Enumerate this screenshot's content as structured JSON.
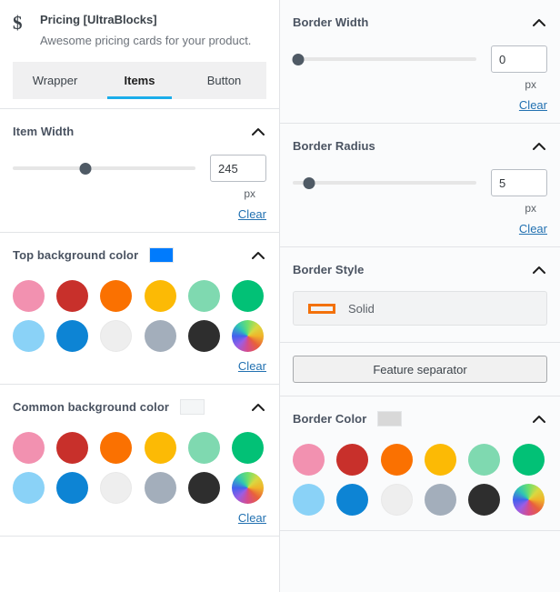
{
  "block_header": {
    "icon": "dollar-icon",
    "icon_glyph": "$",
    "title": "Pricing [UltraBlocks]",
    "description": "Awesome pricing cards for your product."
  },
  "tabs": [
    {
      "label": "Wrapper",
      "active": false
    },
    {
      "label": "Items",
      "active": true
    },
    {
      "label": "Button",
      "active": false
    }
  ],
  "accent_color": "#1badea",
  "link_color": "#2271b1",
  "palette": [
    {
      "name": "pink",
      "hex": "#f291b0",
      "bordered": false
    },
    {
      "name": "red",
      "hex": "#c8302b",
      "bordered": false
    },
    {
      "name": "orange",
      "hex": "#fa7101",
      "bordered": false
    },
    {
      "name": "amber",
      "hex": "#fcba05",
      "bordered": false
    },
    {
      "name": "mint",
      "hex": "#7fd9b0",
      "bordered": false
    },
    {
      "name": "green",
      "hex": "#02c униф76",
      "bordered": false
    },
    {
      "name": "light-blue",
      "hex": "#8ad2f7",
      "bordered": false
    },
    {
      "name": "blue",
      "hex": "#0d84d4",
      "bordered": false
    },
    {
      "name": "white",
      "hex": "#eeeeee",
      "bordered": true
    },
    {
      "name": "gray",
      "hex": "#a3aebb",
      "bordered": false
    },
    {
      "name": "black",
      "hex": "#2e2e2e",
      "bordered": false
    },
    {
      "name": "custom",
      "hex": "wheel",
      "bordered": false
    }
  ],
  "left_panels": {
    "item_width": {
      "title": "Item Width",
      "value": "245",
      "unit": "px",
      "clear_label": "Clear",
      "slider_percent": 40,
      "collapse_icon": "chevron-up-icon"
    },
    "top_background_color": {
      "title": "Top background color",
      "swatch_hex": "#007bfd",
      "clear_label": "Clear",
      "collapse_icon": "chevron-up-icon"
    },
    "common_background_color": {
      "title": "Common background color",
      "swatch_hex": "#f4f6f7",
      "clear_label": "Clear",
      "collapse_icon": "chevron-up-icon"
    }
  },
  "right_panels": {
    "border_width": {
      "title": "Border Width",
      "value": "0",
      "unit": "px",
      "clear_label": "Clear",
      "slider_percent": 2,
      "collapse_icon": "chevron-up-icon"
    },
    "border_radius": {
      "title": "Border Radius",
      "value": "5",
      "unit": "px",
      "clear_label": "Clear",
      "slider_percent": 8,
      "collapse_icon": "chevron-up-icon"
    },
    "border_style": {
      "title": "Border Style",
      "selected_label": "Solid",
      "selected_icon": "solid-line-icon",
      "icon_color": "#f3710a",
      "collapse_icon": "chevron-up-icon"
    },
    "feature_separator": {
      "label": "Feature separator"
    },
    "border_color": {
      "title": "Border Color",
      "swatch_hex": "#d8d8d8",
      "collapse_icon": "chevron-up-icon"
    }
  }
}
